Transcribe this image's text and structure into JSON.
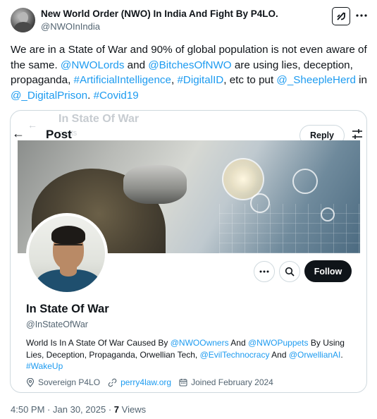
{
  "author": {
    "name": "New World Order (NWO) In India And Fight By P4LO.",
    "handle": "@NWOInIndia"
  },
  "tweet": {
    "segments": [
      {
        "text": "We are in a State of War and 90% of global population is not even aware of the same. ",
        "link": false
      },
      {
        "text": "@NWOLords",
        "link": true
      },
      {
        "text": " and ",
        "link": false
      },
      {
        "text": "@BitchesOfNWO",
        "link": true
      },
      {
        "text": " are using lies, deception, propaganda, ",
        "link": false
      },
      {
        "text": "#ArtificialIntelligence",
        "link": true
      },
      {
        "text": ", ",
        "link": false
      },
      {
        "text": "#DigitalID",
        "link": true
      },
      {
        "text": ", etc to put ",
        "link": false
      },
      {
        "text": "@_SheepleHerd",
        "link": true
      },
      {
        "text": " in ",
        "link": false
      },
      {
        "text": "@_DigitalPrison",
        "link": true
      },
      {
        "text": ". ",
        "link": false
      },
      {
        "text": "#Covid19",
        "link": true
      }
    ]
  },
  "screenshot": {
    "ghost_title": "In State Of War",
    "ghost_posts": "posts",
    "post_title": "Post",
    "reply_label": "Reply",
    "follow_label": "Follow",
    "profile": {
      "name": "In State Of War",
      "handle": "@InStateOfWar",
      "bio": [
        {
          "text": "World Is In A State Of War Caused By ",
          "link": false
        },
        {
          "text": "@NWOOwners",
          "link": true
        },
        {
          "text": " And ",
          "link": false
        },
        {
          "text": "@NWOPuppets",
          "link": true
        },
        {
          "text": " By Using Lies, Deception, Propaganda, Orwellian Tech, ",
          "link": false
        },
        {
          "text": "@EvilTechnocracy",
          "link": true
        },
        {
          "text": " And ",
          "link": false
        },
        {
          "text": "@OrwellianAI",
          "link": true
        },
        {
          "text": ". ",
          "link": false
        },
        {
          "text": "#WakeUp",
          "link": true
        }
      ],
      "location": "Sovereign P4LO",
      "website": "perry4law.org",
      "joined": "Joined February 2024"
    }
  },
  "footer": {
    "time": "4:50 PM",
    "separator": "·",
    "date": "Jan 30, 2025",
    "views_count": "7",
    "views_label": "Views"
  },
  "colors": {
    "link": "#1d9bf0",
    "text": "#0f1419",
    "muted": "#536471",
    "border": "#cfd9de"
  },
  "icons": [
    "grok-icon",
    "more-icon",
    "back-arrow-icon",
    "filter-icon",
    "search-icon",
    "location-icon",
    "link-icon",
    "calendar-icon"
  ]
}
